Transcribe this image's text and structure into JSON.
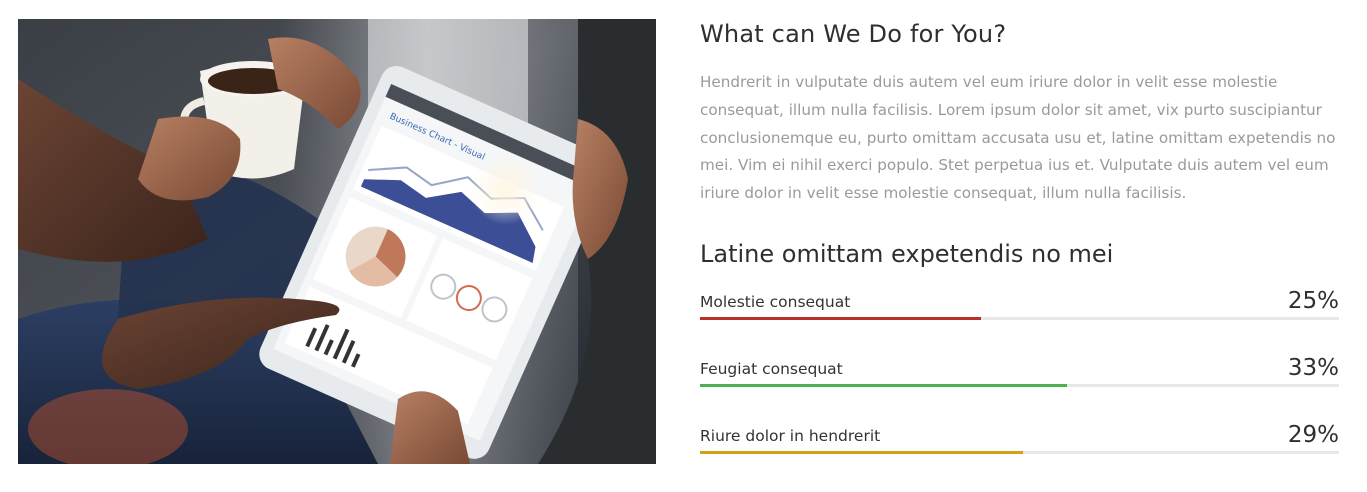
{
  "section": {
    "title": "What can We Do for You?",
    "paragraph": "Hendrerit in vulputate duis autem vel eum iriure dolor in velit esse molestie consequat, illum nulla facilisis. Lorem ipsum dolor sit amet, vix purto suscipiantur conclusionemque eu, purto omittam accusata usu et, latine omittam expetendis no mei. Vim ei nihil exerci populo. Stet perpetua ius et. Vulputate duis autem vel eum iriure dolor in velit esse molestie consequat, illum nulla facilisis.",
    "subtitle": "Latine omittam expetendis no mei"
  },
  "skills": [
    {
      "label": "Molestie consequat",
      "value_text": "25%",
      "percent": 44,
      "color": "#b5312a"
    },
    {
      "label": "Feugiat consequat",
      "value_text": "33%",
      "percent": 57.5,
      "color": "#4caf50"
    },
    {
      "label": "Riure dolor in hendrerit",
      "value_text": "29%",
      "percent": 50.5,
      "color": "#d4a017"
    }
  ],
  "image": {
    "icon": "photo-tablet-coffee",
    "tablet_heading": "Business Chart - Visual"
  }
}
